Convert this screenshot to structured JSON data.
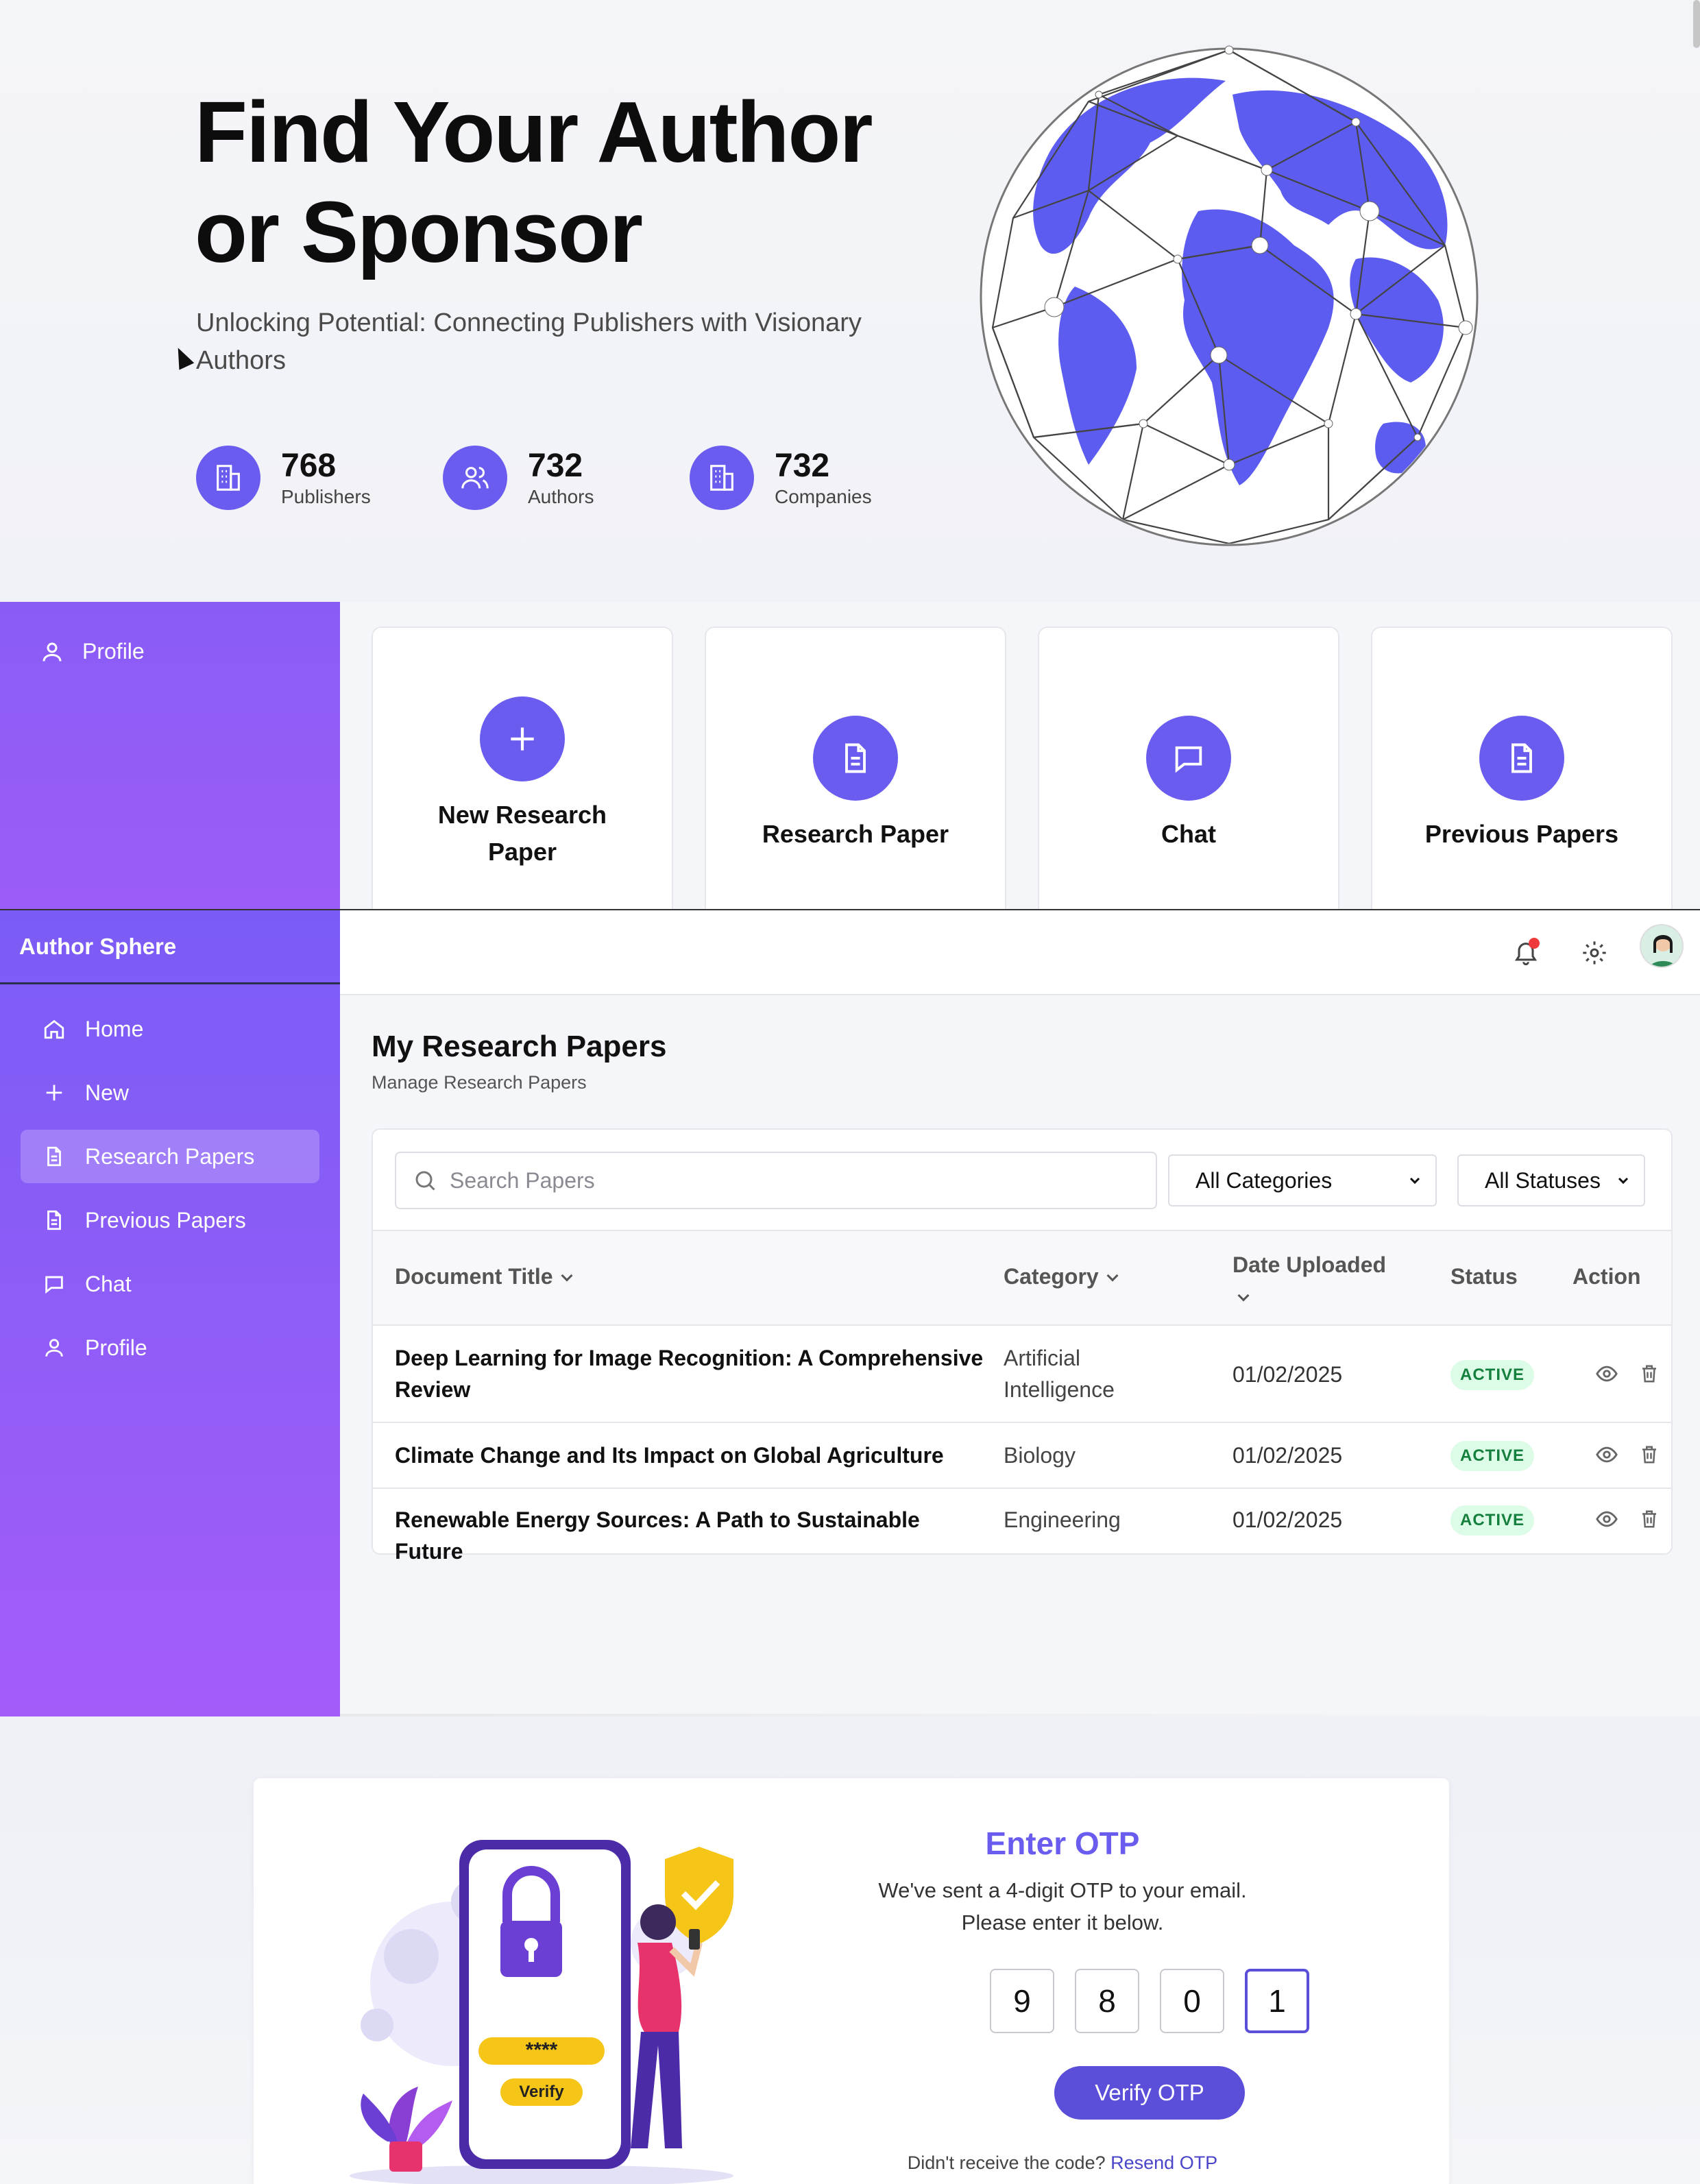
{
  "hero": {
    "title_line1": "Find Your Author",
    "title_line2": "or Sponsor",
    "subtitle_line1": "Unlocking Potential: Connecting Publishers with Visionary",
    "subtitle_line2": "Authors",
    "stats": [
      {
        "value": "768",
        "label": "Publishers",
        "icon": "building-icon"
      },
      {
        "value": "732",
        "label": "Authors",
        "icon": "users-icon"
      },
      {
        "value": "732",
        "label": "Companies",
        "icon": "building-icon"
      }
    ]
  },
  "dashboard": {
    "sidebar_profile": "Profile",
    "cards": [
      {
        "label_line1": "New Research",
        "label_line2": "Paper",
        "icon": "plus-icon"
      },
      {
        "label_line1": "Research Paper",
        "label_line2": "",
        "icon": "document-icon"
      },
      {
        "label_line1": "Chat",
        "label_line2": "",
        "icon": "chat-icon"
      },
      {
        "label_line1": "Previous Papers",
        "label_line2": "",
        "icon": "document-icon"
      }
    ]
  },
  "app": {
    "brand": "Author Sphere",
    "nav": [
      {
        "label": "Home",
        "icon": "home-icon",
        "active": false
      },
      {
        "label": "New",
        "icon": "plus-icon",
        "active": false
      },
      {
        "label": "Research Papers",
        "icon": "document-icon",
        "active": true
      },
      {
        "label": "Previous Papers",
        "icon": "document-icon",
        "active": false
      },
      {
        "label": "Chat",
        "icon": "chat-icon",
        "active": false
      },
      {
        "label": "Profile",
        "icon": "user-icon",
        "active": false
      }
    ],
    "page_title": "My Research Papers",
    "page_subtitle": "Manage Research Papers",
    "search_placeholder": "Search Papers",
    "category_filter": "All Categories",
    "status_filter": "All Statuses",
    "columns": {
      "title": "Document Title",
      "category": "Category",
      "date": "Date Uploaded",
      "status": "Status",
      "action": "Action"
    },
    "rows": [
      {
        "title_line1": "Deep Learning for Image Recognition: A Comprehensive",
        "title_line2": "Review",
        "category_line1": "Artificial",
        "category_line2": "Intelligence",
        "date": "01/02/2025",
        "status": "ACTIVE"
      },
      {
        "title_line1": "Climate Change and Its Impact on Global Agriculture",
        "title_line2": "",
        "category_line1": "Biology",
        "category_line2": "",
        "date": "01/02/2025",
        "status": "ACTIVE"
      },
      {
        "title_line1": "Renewable Energy Sources: A Path to Sustainable Future",
        "title_line2": "",
        "category_line1": "Engineering",
        "category_line2": "",
        "date": "01/02/2025",
        "status": "ACTIVE"
      }
    ]
  },
  "otp": {
    "title": "Enter OTP",
    "message": "We've sent a 4-digit OTP to your email. Please enter it below.",
    "digits": [
      "9",
      "8",
      "0",
      "1"
    ],
    "verify_label": "Verify OTP",
    "resend_prefix": "Didn't receive the code?",
    "resend_link": "Resend OTP",
    "illustration_password": "****",
    "illustration_button": "Verify"
  },
  "colors": {
    "accent": "#6b5cf0",
    "sidebar_top": "#7a5cf5",
    "sidebar_bottom": "#a45cf9",
    "badge_bg": "#dcfce7",
    "badge_text": "#15803d"
  }
}
